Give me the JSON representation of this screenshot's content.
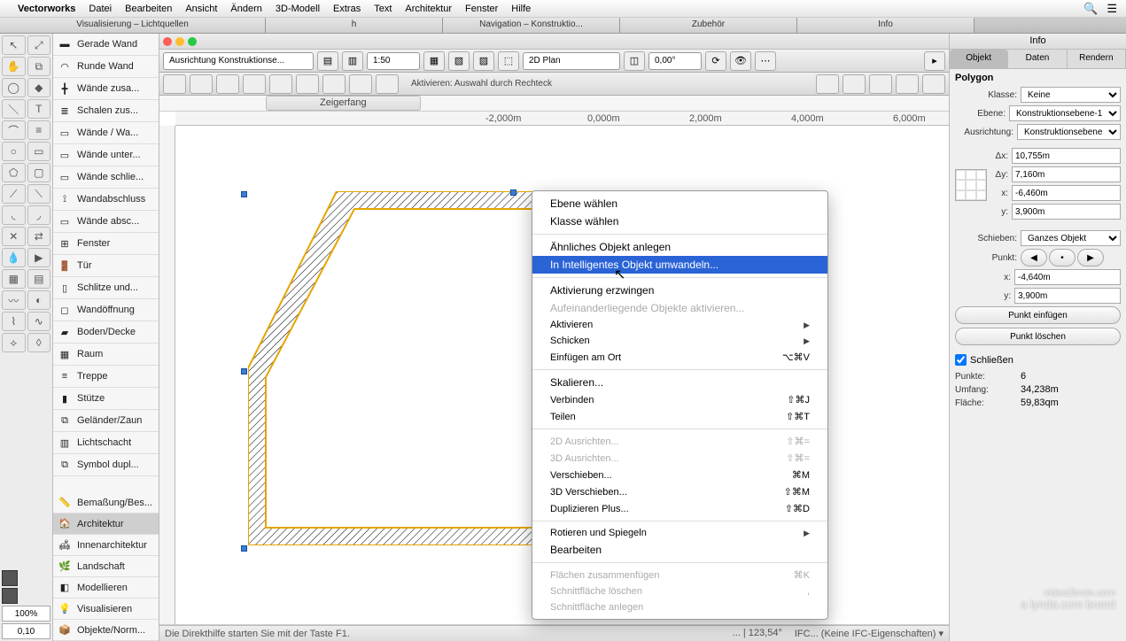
{
  "menubar": {
    "app": "Vectorworks",
    "items": [
      "Datei",
      "Bearbeiten",
      "Ansicht",
      "Ändern",
      "3D-Modell",
      "Extras",
      "Text",
      "Architektur",
      "Fenster",
      "Hilfe"
    ]
  },
  "tabs": {
    "t0": "Visualisierung – Lichtquellen",
    "t1": "h",
    "t2": "Navigation – Konstruktio...",
    "t3": "Zubehör",
    "t4": "Info"
  },
  "palette": {
    "items": [
      "Gerade Wand",
      "Runde Wand",
      "Wände zusa...",
      "Schalen zus...",
      "Wände / Wa...",
      "Wände unter...",
      "Wände schlie...",
      "Wandabschluss",
      "Wände absc...",
      "Fenster",
      "Tür",
      "Schlitze und...",
      "Wandöffnung",
      "Boden/Decke",
      "Raum",
      "Treppe",
      "Stütze",
      "Geländer/Zaun",
      "Lichtschacht",
      "Symbol dupl..."
    ],
    "tabs": [
      "Bemaßung/Bes...",
      "Architektur",
      "Innenarchitektur",
      "Landschaft",
      "Modellieren",
      "Visualisieren",
      "Objekte/Norm..."
    ],
    "activeTab": 1
  },
  "zoom": {
    "pct": "100%",
    "step": "0,10"
  },
  "topbar": {
    "layersel": "Ausrichtung Konstruktionse...",
    "scale": "1:50",
    "view": "2D Plan",
    "angle": "0,00°"
  },
  "modebar": {
    "status": "Aktivieren:  Auswahl durch Rechteck"
  },
  "snap": {
    "label": "Zeigerfang"
  },
  "ruler": {
    "m2n": "-2,000m",
    "m0": "0,000m",
    "m2": "2,000m",
    "m4": "4,000m",
    "m6": "6,000m"
  },
  "ctx": {
    "i0": "Ebene wählen",
    "i1": "Klasse wählen",
    "i2": "Ähnliches Objekt anlegen",
    "i3": "In Intelligentes Objekt umwandeln...",
    "i4": "Aktivierung erzwingen",
    "i5": "Aufeinanderliegende Objekte aktivieren...",
    "i6": "Aktivieren",
    "i7": "Schicken",
    "i8": "Einfügen am Ort",
    "i8s": "⌥⌘V",
    "i9": "Skalieren...",
    "i10": "Verbinden",
    "i10s": "⇧⌘J",
    "i11": "Teilen",
    "i11s": "⇧⌘T",
    "i12": "2D Ausrichten...",
    "i12s": "⇧⌘=",
    "i13": "3D Ausrichten...",
    "i13s": "⇧⌘=",
    "i14": "Verschieben...",
    "i14s": "⌘M",
    "i15": "3D Verschieben...",
    "i15s": "⇧⌘M",
    "i16": "Duplizieren Plus...",
    "i16s": "⇧⌘D",
    "i17": "Rotieren und Spiegeln",
    "i18": "Bearbeiten",
    "i19": "Flächen zusammenfügen",
    "i19s": "⌘K",
    "i20": "Schnittfläche löschen",
    "i20s": ",",
    "i21": "Schnittfläche anlegen"
  },
  "info": {
    "title": "Info",
    "tabs": {
      "t0": "Objekt",
      "t1": "Daten",
      "t2": "Rendern"
    },
    "objtype": "Polygon",
    "klasse_l": "Klasse:",
    "klasse_v": "Keine",
    "ebene_l": "Ebene:",
    "ebene_v": "Konstruktionsebene-1",
    "ausr_l": "Ausrichtung:",
    "ausr_v": "Konstruktionsebene",
    "dx_l": "Δx:",
    "dx_v": "10,755m",
    "dy_l": "Δy:",
    "dy_v": "7,160m",
    "x_l": "x:",
    "x_v": "-6,460m",
    "y_l": "y:",
    "y_v": "3,900m",
    "schieben_l": "Schieben:",
    "schieben_v": "Ganzes Objekt",
    "punkt_l": "Punkt:",
    "x2_l": "x:",
    "x2_v": "-4,640m",
    "y2_l": "y:",
    "y2_v": "3,900m",
    "btn_add": "Punkt einfügen",
    "btn_del": "Punkt löschen",
    "close_l": "Schließen",
    "pts_l": "Punkte:",
    "pts_v": "6",
    "umf_l": "Umfang:",
    "umf_v": "34,238m",
    "fl_l": "Fläche:",
    "fl_v": "59,83qm"
  },
  "status": {
    "help": "Die Direkthilfe starten Sie mit der Taste F1.",
    "coord": "... | 123,54°",
    "ifc": "IFC... (Keine IFC-Eigenschaften) ▾"
  },
  "watermark": {
    "l1": "video2brain.com",
    "l2": "a lynda.com brand"
  }
}
